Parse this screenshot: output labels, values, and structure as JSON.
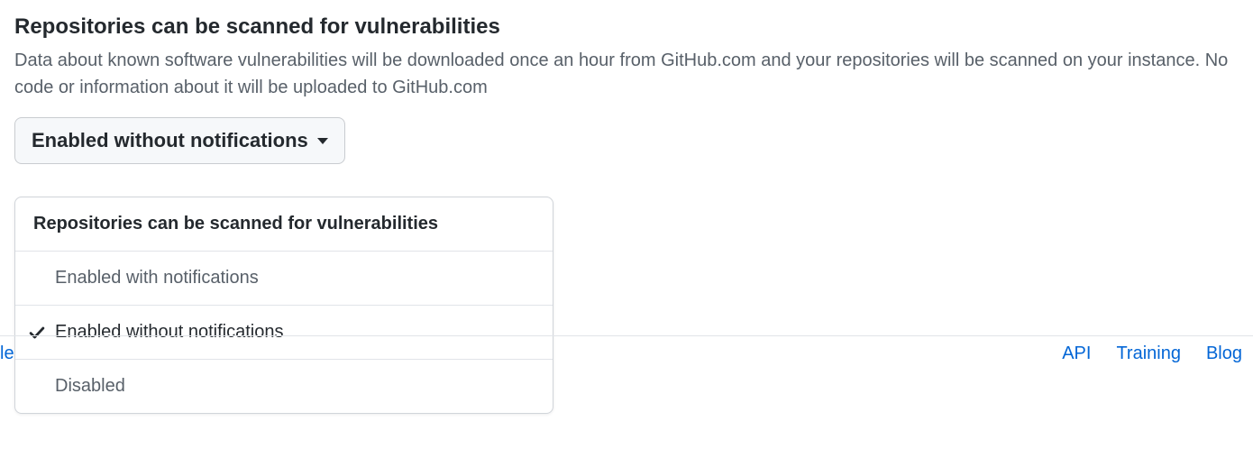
{
  "section": {
    "title": "Repositories can be scanned for vulnerabilities",
    "description": "Data about known software vulnerabilities will be downloaded once an hour from GitHub.com and your repositories will be scanned on your instance. No code or information about it will be uploaded to GitHub.com"
  },
  "dropdown": {
    "selected_label": "Enabled without notifications",
    "menu_header": "Repositories can be scanned for vulnerabilities",
    "options": [
      {
        "label": "Enabled with notifications",
        "selected": false
      },
      {
        "label": "Enabled without notifications",
        "selected": true
      },
      {
        "label": "Disabled",
        "selected": false
      }
    ]
  },
  "footer": {
    "partial_left": "le",
    "links": [
      {
        "label": "API"
      },
      {
        "label": "Training"
      },
      {
        "label": "Blog"
      }
    ]
  }
}
